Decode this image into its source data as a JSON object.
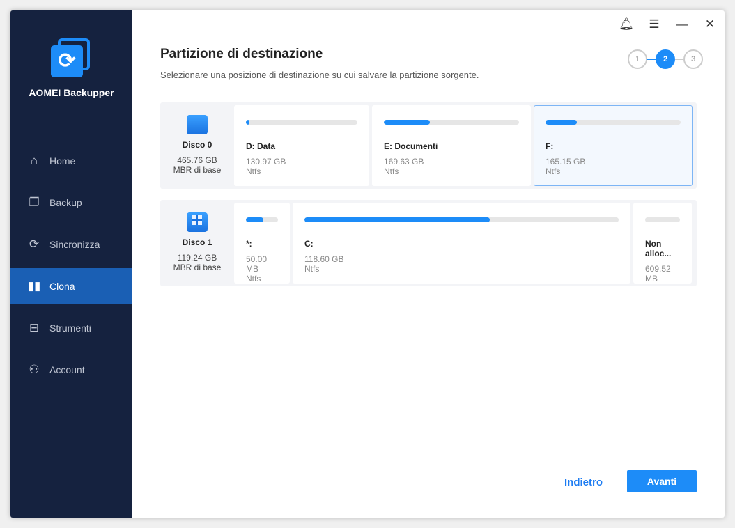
{
  "app": {
    "name": "AOMEI Backupper"
  },
  "sidebar": {
    "items": [
      {
        "label": "Home",
        "icon": "home-icon"
      },
      {
        "label": "Backup",
        "icon": "backup-icon"
      },
      {
        "label": "Sincronizza",
        "icon": "sync-icon"
      },
      {
        "label": "Clona",
        "icon": "clone-icon",
        "active": true
      },
      {
        "label": "Strumenti",
        "icon": "tools-icon"
      },
      {
        "label": "Account",
        "icon": "account-icon"
      }
    ]
  },
  "header": {
    "title": "Partizione di destinazione",
    "subtitle": "Selezionare una posizione di destinazione su cui salvare la partizione sorgente.",
    "steps": [
      "1",
      "2",
      "3"
    ],
    "current_step": 2
  },
  "disks": [
    {
      "name": "Disco 0",
      "size": "465.76 GB",
      "type": "MBR di base",
      "partitions": [
        {
          "name": "D: Data",
          "size": "130.97 GB",
          "fs": "Ntfs",
          "used": 0.03
        },
        {
          "name": "E: Documenti",
          "size": "169.63 GB",
          "fs": "Ntfs",
          "used": 0.34
        },
        {
          "name": "F:",
          "size": "165.15 GB",
          "fs": "Ntfs",
          "used": 0.23,
          "selected": true
        }
      ]
    },
    {
      "name": "Disco 1",
      "size": "119.24 GB",
      "type": "MBR di base",
      "partitions": [
        {
          "name": "*:",
          "size": "50.00 MB",
          "fs": "Ntfs",
          "used": 0.55
        },
        {
          "name": "C:",
          "size": "118.60 GB",
          "fs": "Ntfs",
          "used": 0.59
        },
        {
          "name": "Non alloc...",
          "size": "609.52 MB",
          "used": 0
        }
      ]
    }
  ],
  "footer": {
    "back": "Indietro",
    "next": "Avanti"
  },
  "colors": {
    "accent": "#1d8cf8",
    "sidebar": "#15223f",
    "active": "#1a5fb4"
  }
}
